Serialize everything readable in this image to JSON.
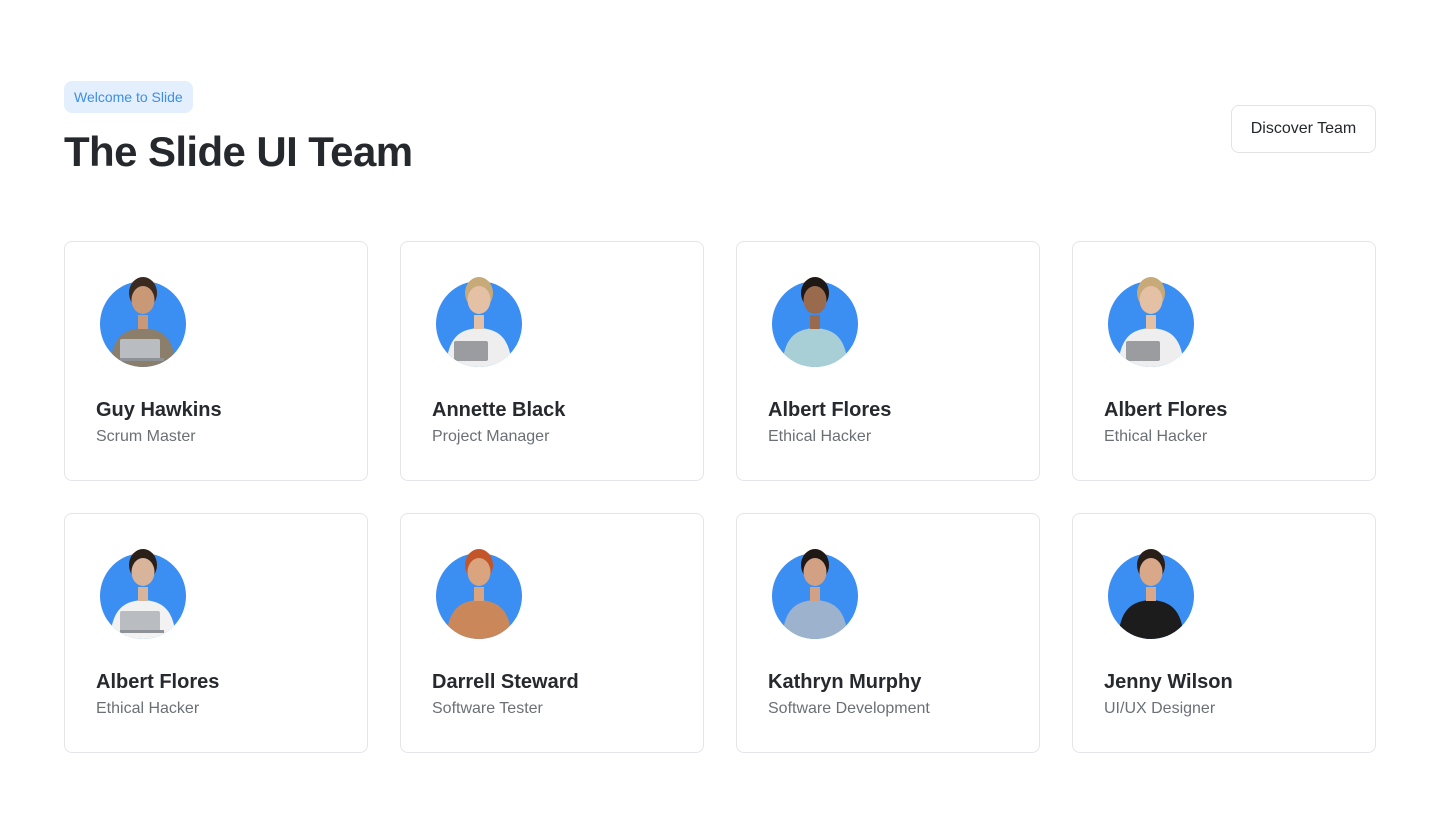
{
  "header": {
    "badge": "Welcome to Slide",
    "title": "The Slide UI Team",
    "discover_button": "Discover Team"
  },
  "colors": {
    "accent": "#3d8ee8",
    "avatar_bg": "#3b8ef2",
    "badge_bg": "#e3effd"
  },
  "team": [
    {
      "name": "Guy Hawkins",
      "role": "Scrum Master",
      "hair": "#3a2a20",
      "skin": "#c99877",
      "shirt": "#8b7e6a",
      "prop": "laptop"
    },
    {
      "name": "Annette Black",
      "role": "Project Manager",
      "hair": "#c8a978",
      "skin": "#e4c0a4",
      "shirt": "#eeeeee",
      "prop": "tablet"
    },
    {
      "name": "Albert Flores",
      "role": "Ethical Hacker",
      "hair": "#1e1714",
      "skin": "#9a6a4c",
      "shirt": "#a9cfd6",
      "prop": "none"
    },
    {
      "name": "Albert Flores",
      "role": "Ethical Hacker",
      "hair": "#c8a978",
      "skin": "#e4c0a4",
      "shirt": "#eeeeee",
      "prop": "tablet"
    },
    {
      "name": "Albert Flores",
      "role": "Ethical Hacker",
      "hair": "#2b2018",
      "skin": "#d8b49a",
      "shirt": "#f2f2f2",
      "prop": "laptop"
    },
    {
      "name": "Darrell Steward",
      "role": "Software Tester",
      "hair": "#c2562a",
      "skin": "#d9a47e",
      "shirt": "#c9875a",
      "prop": "none"
    },
    {
      "name": "Kathryn Murphy",
      "role": "Software Development",
      "hair": "#1f1814",
      "skin": "#d2a183",
      "shirt": "#9db2cc",
      "prop": "none"
    },
    {
      "name": "Jenny Wilson",
      "role": "UI/UX Designer",
      "hair": "#2a1e18",
      "skin": "#d8a888",
      "shirt": "#1c1c1c",
      "prop": "none"
    }
  ]
}
